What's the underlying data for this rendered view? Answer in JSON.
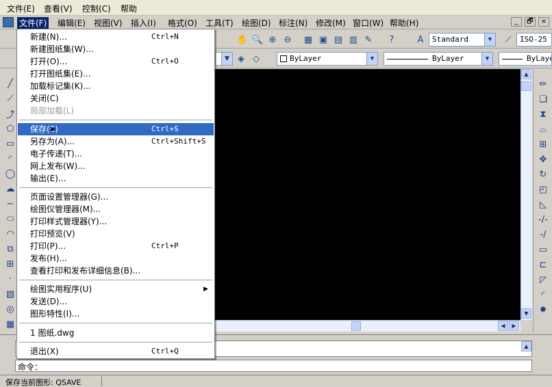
{
  "host_menu": {
    "items": [
      "文件(E)",
      "查看(V)",
      "控制(C)",
      "帮助"
    ]
  },
  "app_menu": {
    "items": [
      "文件(F)",
      "编辑(E)",
      "视图(V)",
      "插入(I)",
      "格式(O)",
      "工具(T)",
      "绘图(D)",
      "标注(N)",
      "修改(M)",
      "窗口(W)",
      "帮助(H)"
    ],
    "window_buttons": [
      "_",
      "🗗",
      "×"
    ]
  },
  "toolbar": {
    "text_style": "Standard",
    "dim_style": "ISO-25",
    "color": "ByLayer",
    "linetype": "ByLayer",
    "lineweight": "ByLayer"
  },
  "file_menu": {
    "items": [
      {
        "label": "新建(N)...",
        "shortcut": "Ctrl+N"
      },
      {
        "label": "新建图纸集(W)...",
        "shortcut": ""
      },
      {
        "label": "打开(O)...",
        "shortcut": "Ctrl+O"
      },
      {
        "label": "打开图纸集(E)...",
        "shortcut": ""
      },
      {
        "label": "加载标记集(K)...",
        "shortcut": ""
      },
      {
        "label": "关闭(C)",
        "shortcut": ""
      },
      {
        "label": "局部加载(L)",
        "shortcut": ""
      },
      {
        "label": "保存(S)",
        "shortcut": "Ctrl+S"
      },
      {
        "label": "另存为(A)...",
        "shortcut": "Ctrl+Shift+S"
      },
      {
        "label": "电子传递(T)...",
        "shortcut": ""
      },
      {
        "label": "网上发布(W)...",
        "shortcut": ""
      },
      {
        "label": "输出(E)...",
        "shortcut": ""
      },
      {
        "label": "页面设置管理器(G)...",
        "shortcut": ""
      },
      {
        "label": "绘图仪管理器(M)...",
        "shortcut": ""
      },
      {
        "label": "打印样式管理器(Y)...",
        "shortcut": ""
      },
      {
        "label": "打印预览(V)",
        "shortcut": ""
      },
      {
        "label": "打印(P)...",
        "shortcut": "Ctrl+P"
      },
      {
        "label": "发布(H)...",
        "shortcut": ""
      },
      {
        "label": "查看打印和发布详细信息(B)...",
        "shortcut": ""
      },
      {
        "label": "绘图实用程序(U)",
        "shortcut": ""
      },
      {
        "label": "发送(D)...",
        "shortcut": ""
      },
      {
        "label": "图形特性(I)...",
        "shortcut": ""
      },
      {
        "label": "1 图纸.dwg",
        "shortcut": ""
      },
      {
        "label": "退出(X)",
        "shortcut": "Ctrl+Q"
      }
    ]
  },
  "command": {
    "prompt": "命令："
  },
  "status": {
    "text": "保存当前图形:  QSAVE"
  }
}
